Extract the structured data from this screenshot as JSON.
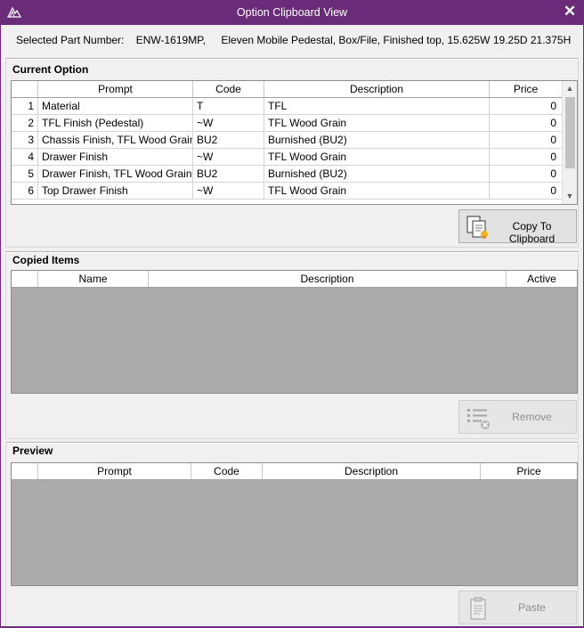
{
  "window": {
    "title": "Option Clipboard View",
    "close_glyph": "✕"
  },
  "part": {
    "label": "Selected Part Number:",
    "number": "ENW-1619MP,",
    "description": "Eleven Mobile Pedestal, Box/File, Finished top, 15.625W 19.25D 21.375H"
  },
  "current_option": {
    "title": "Current Option",
    "columns": [
      "Prompt",
      "Code",
      "Description",
      "Price"
    ],
    "rows": [
      {
        "idx": "1",
        "prompt": "Material",
        "code": "T",
        "description": "TFL",
        "price": "0"
      },
      {
        "idx": "2",
        "prompt": "TFL Finish (Pedestal)",
        "code": "~W",
        "description": "TFL Wood Grain",
        "price": "0"
      },
      {
        "idx": "3",
        "prompt": "Chassis Finish, TFL Wood Grain",
        "code": "BU2",
        "description": "Burnished (BU2)",
        "price": "0"
      },
      {
        "idx": "4",
        "prompt": "Drawer Finish",
        "code": "~W",
        "description": "TFL Wood Grain",
        "price": "0"
      },
      {
        "idx": "5",
        "prompt": "Drawer Finish, TFL Wood Grain",
        "code": "BU2",
        "description": "Burnished (BU2)",
        "price": "0"
      },
      {
        "idx": "6",
        "prompt": "Top Drawer Finish",
        "code": "~W",
        "description": "TFL Wood Grain",
        "price": "0"
      }
    ],
    "copy_button": "Copy To Clipboard"
  },
  "copied_items": {
    "title": "Copied Items",
    "columns": [
      "Name",
      "Description",
      "Active"
    ],
    "remove_button": "Remove"
  },
  "preview": {
    "title": "Preview",
    "columns": [
      "Prompt",
      "Code",
      "Description",
      "Price"
    ],
    "paste_button": "Paste"
  },
  "colors": {
    "titlebar": "#6a2c79",
    "grid_empty": "#ababab"
  },
  "icons": {
    "app": "app-logo-icon",
    "close": "close-icon",
    "copy": "copy-clipboard-icon",
    "remove": "remove-list-icon",
    "paste": "paste-icon",
    "scroll_up": "chevron-up-icon",
    "scroll_down": "chevron-down-icon"
  }
}
